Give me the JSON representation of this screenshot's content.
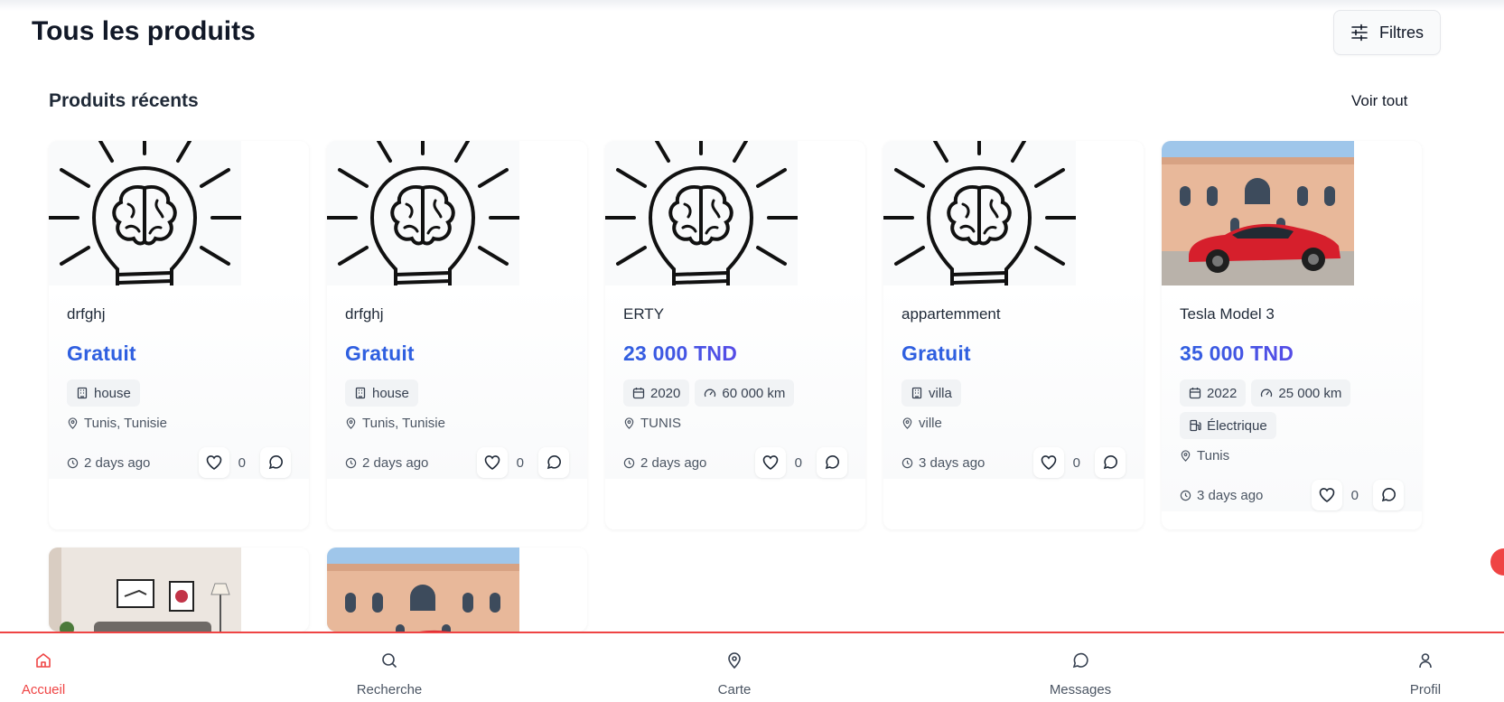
{
  "page": {
    "title": "Tous les produits",
    "filters_label": "Filtres"
  },
  "section": {
    "title": "Produits récents",
    "see_all": "Voir tout"
  },
  "products": [
    {
      "title": "drfghj",
      "price": "Gratuit",
      "tags": [
        "house"
      ],
      "location": "Tunis, Tunisie",
      "time": "2 days ago",
      "likes": "0"
    },
    {
      "title": "drfghj",
      "price": "Gratuit",
      "tags": [
        "house"
      ],
      "location": "Tunis, Tunisie",
      "time": "2 days ago",
      "likes": "0"
    },
    {
      "title": "ERTY",
      "price": "23 000 TND",
      "tags": [
        "2020",
        "60 000 km"
      ],
      "location": "TUNIS",
      "time": "2 days ago",
      "likes": "0"
    },
    {
      "title": "appartemment",
      "price": "Gratuit",
      "tags": [
        "villa"
      ],
      "location": "ville",
      "time": "3 days ago",
      "likes": "0"
    },
    {
      "title": "Tesla Model 3",
      "price": "35 000 TND",
      "tags": [
        "2022",
        "25 000 km",
        "Électrique"
      ],
      "location": "Tunis",
      "time": "3 days ago",
      "likes": "0"
    }
  ],
  "nav": [
    {
      "label": "Accueil",
      "icon": "home-icon",
      "active": true
    },
    {
      "label": "Recherche",
      "icon": "search-icon"
    },
    {
      "label": "Carte",
      "icon": "map-pin-icon"
    },
    {
      "label": "Messages",
      "icon": "message-icon"
    },
    {
      "label": "Profil",
      "icon": "user-icon"
    }
  ],
  "colors": {
    "accent": "#ef4444",
    "price_blue": "#2f5fe0",
    "price_purple": "#7c3aed"
  }
}
